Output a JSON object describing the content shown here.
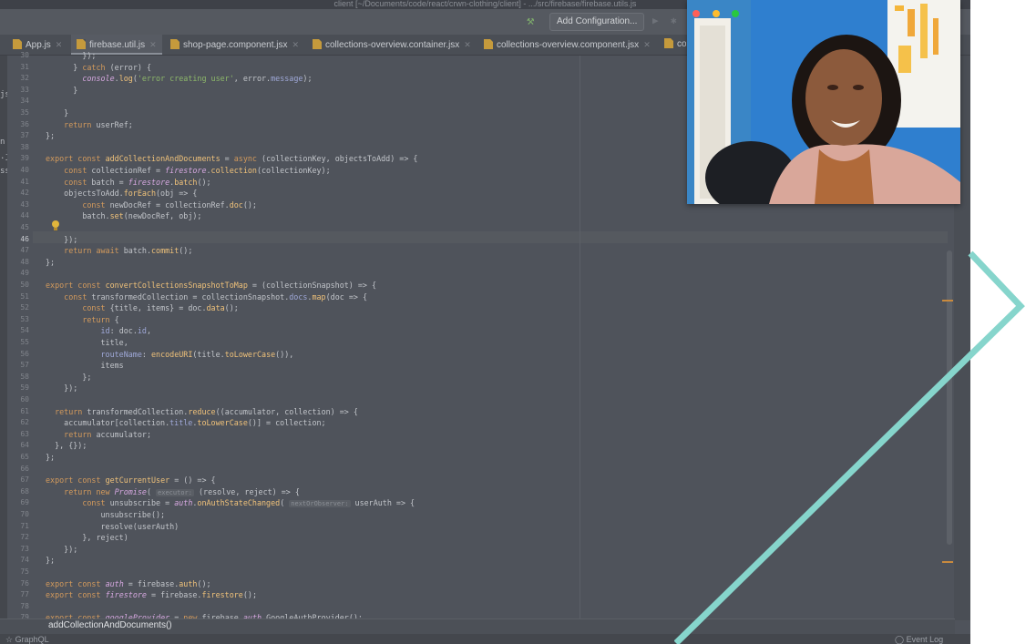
{
  "window": {
    "title": "client [~/Documents/code/react/crwn-clothing/client] - .../src/firebase/firebase.utils.js"
  },
  "toolbar": {
    "add_configuration_label": "Add Configuration...",
    "run_icon": "play-icon",
    "debug_icon": "debug-icon",
    "build_icon": "hammer-icon"
  },
  "tabs": [
    {
      "label": "App.js",
      "active": false
    },
    {
      "label": "firebase.util.js",
      "active": true
    },
    {
      "label": "shop-page.component.jsx",
      "active": false
    },
    {
      "label": "collections-overview.container.jsx",
      "active": false
    },
    {
      "label": "collections-overview.component.jsx",
      "active": false
    },
    {
      "label": "co",
      "active": false
    }
  ],
  "left_gutter_chars": [
    "js",
    "n",
    ".j",
    "ss"
  ],
  "line_numbers": [
    "30",
    "31",
    "32",
    "33",
    "34",
    "35",
    "36",
    "37",
    "38",
    "39",
    "40",
    "41",
    "42",
    "43",
    "44",
    "45",
    "46",
    "47",
    "48",
    "49",
    "50",
    "51",
    "52",
    "53",
    "54",
    "55",
    "56",
    "57",
    "58",
    "59",
    "60",
    "61",
    "62",
    "63",
    "64",
    "65",
    "66",
    "67",
    "68",
    "69",
    "70",
    "71",
    "72",
    "73",
    "74",
    "75",
    "76",
    "77",
    "78",
    "79"
  ],
  "current_line": "46",
  "breadcrumb": "addCollectionAndDocuments()",
  "status": {
    "left": "GraphQL",
    "right": "Event Log"
  },
  "colors": {
    "accent_line": "#86d5cc",
    "ide_background": "#4f535b"
  }
}
